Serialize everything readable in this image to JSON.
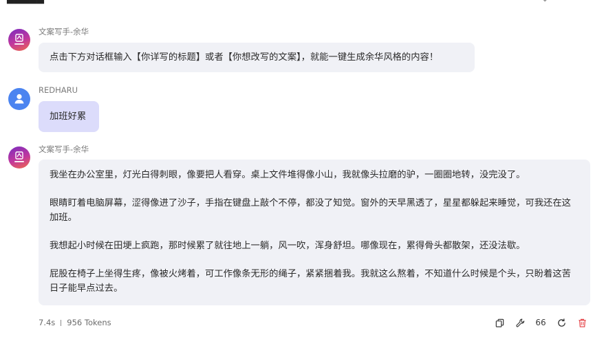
{
  "conversation": {
    "messages": [
      {
        "role": "assistant",
        "sender": "文案写手-余华",
        "avatar_icon": "writer-bot-avatar",
        "paragraphs": [
          "点击下方对话框输入【你详写的标题】或者【你想改写的文案】，就能一键生成余华风格的内容！"
        ]
      },
      {
        "role": "user",
        "sender": "REDHARU",
        "avatar_icon": "user-avatar",
        "paragraphs": [
          "加班好累"
        ]
      },
      {
        "role": "assistant",
        "sender": "文案写手-余华",
        "avatar_icon": "writer-bot-avatar",
        "paragraphs": [
          "我坐在办公室里，灯光白得刺眼，像要把人看穿。桌上文件堆得像小山，我就像头拉磨的驴，一圈圈地转，没完没了。",
          "眼睛盯着电脑屏幕，涩得像进了沙子，手指在键盘上敲个不停，都没了知觉。窗外的天早黑透了，星星都躲起来睡觉，可我还在这加班。",
          "我想起小时候在田埂上疯跑，那时候累了就往地上一躺，风一吹，浑身舒坦。哪像现在，累得骨头都散架，还没法歇。",
          "屁股在椅子上坐得生疼，像被火烤着，可工作像条无形的绳子，紧紧捆着我。我就这么熬着，不知道什么时候是个头，只盼着这苦日子能早点过去。"
        ]
      }
    ],
    "stats": {
      "duration": "7.4s",
      "tokens": "956 Tokens"
    },
    "actions": [
      {
        "icon": "copy-icon"
      },
      {
        "icon": "wrench-icon"
      },
      {
        "icon": "quote-icon",
        "glyph": "66"
      },
      {
        "icon": "regenerate-icon"
      },
      {
        "icon": "delete-icon"
      }
    ],
    "colors": {
      "bubble_bg": "#f0f1f6",
      "user_bubble_bg": "#dcdcfb",
      "user_avatar": "#4b84f0",
      "delete_red": "#e5484d"
    }
  }
}
